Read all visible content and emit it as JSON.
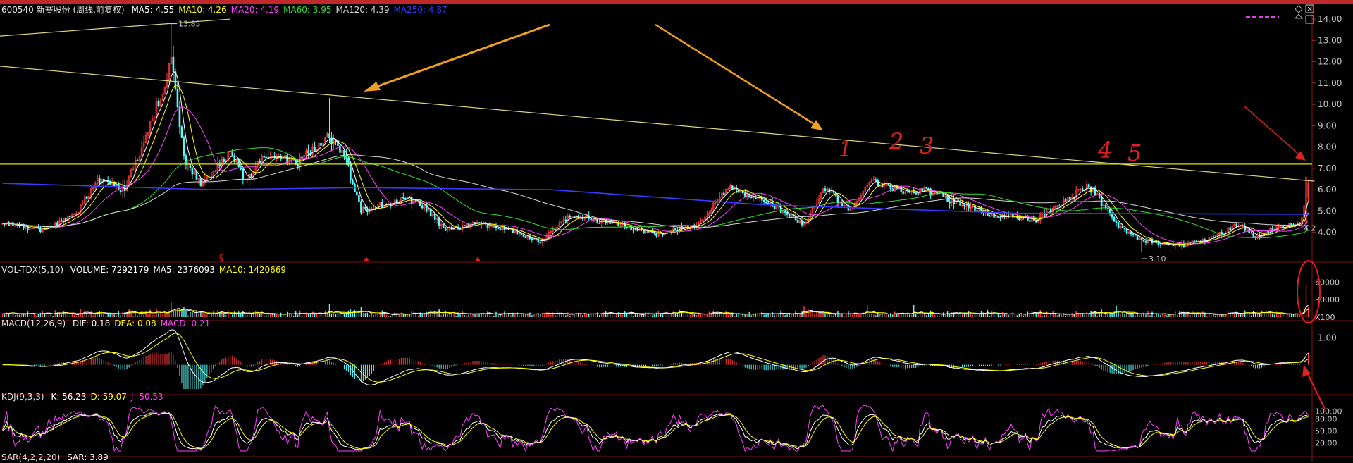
{
  "header": {
    "symbol": "600540 新赛股份 (周线,前复权)",
    "ma": [
      {
        "label": "MA5: 4.55",
        "color": "#ffffff"
      },
      {
        "label": "MA10: 4.26",
        "color": "#ffff00"
      },
      {
        "label": "MA20: 4.19",
        "color": "#ff40ff"
      },
      {
        "label": "MA60: 3.95",
        "color": "#33dd33"
      },
      {
        "label": "MA120: 4.39",
        "color": "#d8d8d8"
      },
      {
        "label": "MA250: 4.87",
        "color": "#3a3aff"
      }
    ]
  },
  "volume_header": {
    "name": "VOL-TDX(5,10)",
    "items": [
      {
        "label": "VOLUME: 7292179",
        "color": "#ffffff"
      },
      {
        "label": "MA5: 2376093",
        "color": "#ffffff"
      },
      {
        "label": "MA10: 1420669",
        "color": "#ffff00"
      }
    ]
  },
  "macd_header": {
    "name": "MACD(12,26,9)",
    "items": [
      {
        "label": "DIF: 0.18",
        "color": "#ffffff"
      },
      {
        "label": "DEA: 0.08",
        "color": "#ffff00"
      },
      {
        "label": "MACD: 0.21",
        "color": "#ff40ff"
      }
    ]
  },
  "kdj_header": {
    "name": "KDJ(9,3,3)",
    "items": [
      {
        "label": "K: 56.23",
        "color": "#ffffff"
      },
      {
        "label": "D: 59.07",
        "color": "#ffff00"
      },
      {
        "label": "J: 50.53",
        "color": "#ff40ff"
      }
    ]
  },
  "sar_header": {
    "name": "SAR(4,2,2,20)",
    "items": [
      {
        "label": "SAR: 3.89",
        "color": "#ffffff"
      }
    ]
  },
  "chart_data": [
    {
      "type": "candlestick",
      "panel": "price",
      "ylim": [
        3,
        14.3
      ],
      "yticks": [
        {
          "v": 14,
          "label": "14.00"
        },
        {
          "v": 13,
          "label": "13.00"
        },
        {
          "v": 12,
          "label": "12.00"
        },
        {
          "v": 11,
          "label": "11.00"
        },
        {
          "v": 10,
          "label": "10.00"
        },
        {
          "v": 9,
          "label": "9.00"
        },
        {
          "v": 8,
          "label": "8.00"
        },
        {
          "v": 7,
          "label": "7.00"
        },
        {
          "v": 6,
          "label": "6.00"
        },
        {
          "v": 5,
          "label": "5.00"
        },
        {
          "v": 4,
          "label": "4.00"
        }
      ],
      "x_range": [
        0,
        620
      ],
      "anchors": [
        [
          0,
          4.4
        ],
        [
          20,
          4.1
        ],
        [
          35,
          4.9
        ],
        [
          45,
          6.5
        ],
        [
          58,
          6.0
        ],
        [
          70,
          9.0
        ],
        [
          80,
          12.0
        ],
        [
          86,
          7.5
        ],
        [
          95,
          6.2
        ],
        [
          108,
          7.8
        ],
        [
          115,
          6.4
        ],
        [
          125,
          7.6
        ],
        [
          140,
          7.3
        ],
        [
          155,
          8.5
        ],
        [
          162,
          7.6
        ],
        [
          170,
          5.0
        ],
        [
          190,
          5.6
        ],
        [
          200,
          5.2
        ],
        [
          210,
          4.1
        ],
        [
          225,
          4.4
        ],
        [
          240,
          4.1
        ],
        [
          255,
          3.6
        ],
        [
          270,
          4.8
        ],
        [
          290,
          4.4
        ],
        [
          310,
          3.9
        ],
        [
          330,
          4.4
        ],
        [
          345,
          6.2
        ],
        [
          360,
          5.5
        ],
        [
          370,
          5.0
        ],
        [
          380,
          4.3
        ],
        [
          390,
          6.1
        ],
        [
          402,
          5.0
        ],
        [
          410,
          6.4
        ],
        [
          425,
          6.0
        ],
        [
          440,
          5.9
        ],
        [
          450,
          5.5
        ],
        [
          470,
          4.8
        ],
        [
          490,
          4.6
        ],
        [
          505,
          5.6
        ],
        [
          515,
          6.2
        ],
        [
          528,
          4.4
        ],
        [
          540,
          3.6
        ],
        [
          560,
          3.4
        ],
        [
          575,
          3.8
        ],
        [
          585,
          4.4
        ],
        [
          595,
          3.8
        ],
        [
          605,
          4.3
        ],
        [
          615,
          4.4
        ],
        [
          620,
          6.6
        ]
      ],
      "extremes": [
        {
          "x": 80,
          "label": "13.85"
        },
        {
          "x": 540,
          "label": "3.10"
        }
      ],
      "last_price_label": "4.2",
      "trendlines": [
        {
          "x1": -2,
          "y1": 13.2,
          "x2": 108,
          "y2": 14.0,
          "color": "#d8d880"
        },
        {
          "x1": -2,
          "y1": 11.8,
          "x2": 622,
          "y2": 6.4,
          "color": "#d8d880"
        }
      ],
      "hline": {
        "y": 7.2,
        "color": "#e6e600"
      },
      "blue_ma_anchors": [
        [
          0,
          6.3
        ],
        [
          100,
          6.0
        ],
        [
          170,
          6.1
        ],
        [
          260,
          6.0
        ],
        [
          360,
          5.3
        ],
        [
          480,
          4.9
        ],
        [
          620,
          4.85
        ]
      ]
    },
    {
      "type": "bar",
      "panel": "volume",
      "ylim": [
        0,
        70000
      ],
      "yticks": [
        {
          "v": 60000,
          "label": "60000"
        },
        {
          "v": 30000,
          "label": "30000"
        },
        {
          "v": 0,
          "label": "X100"
        }
      ],
      "last_value": 55000
    },
    {
      "type": "macd",
      "panel": "macd",
      "ylim": [
        -0.9,
        1.3
      ],
      "yticks": [
        {
          "v": 1.0,
          "label": "1.00"
        }
      ]
    },
    {
      "type": "line",
      "panel": "kdj",
      "ylim": [
        0,
        120
      ],
      "yticks": [
        {
          "v": 100,
          "label": "100.00"
        },
        {
          "v": 80,
          "label": "80.00"
        },
        {
          "v": 50,
          "label": "50.00"
        },
        {
          "v": 20,
          "label": "20.00"
        }
      ]
    }
  ],
  "annotations": {
    "handwritten": [
      "1",
      "2",
      "3",
      "4",
      "5"
    ]
  }
}
